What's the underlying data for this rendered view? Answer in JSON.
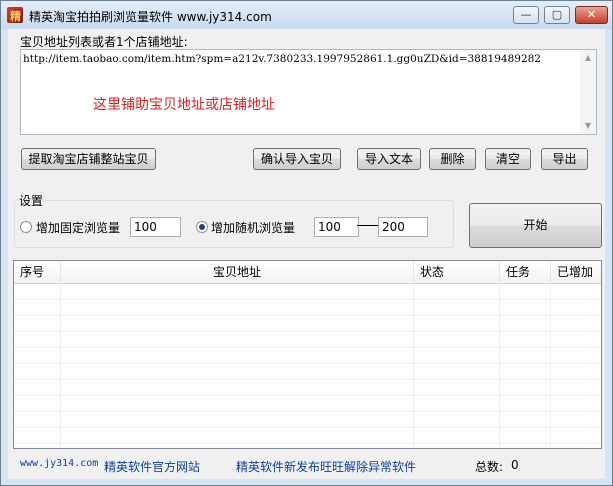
{
  "window": {
    "title": "精英淘宝拍拍刷浏览量软件 www.jy314.com",
    "minimize_glyph": "—",
    "maximize_glyph": "▢",
    "close_glyph": "✕"
  },
  "url_section": {
    "label": "宝贝地址列表或者1个店铺地址:",
    "value": "http://item.taobao.com/item.htm?spm=a212v.7380233.1997952861.1.gg0uZD&id=38819489282",
    "hint": "这里铺助宝贝地址或店铺地址"
  },
  "buttons": {
    "fetch_shop": "提取淘宝店铺整站宝贝",
    "confirm_import": "确认导入宝贝",
    "import_text": "导入文本",
    "delete": "删除",
    "clear": "清空",
    "export": "导出",
    "start": "开始"
  },
  "settings": {
    "title": "设置",
    "fixed_label": "增加固定浏览量",
    "fixed_selected": false,
    "fixed_value": "100",
    "random_label": "增加随机浏览量",
    "random_selected": true,
    "random_min": "100",
    "random_max": "200"
  },
  "table": {
    "columns": [
      "序号",
      "宝贝地址",
      "状态",
      "任务",
      "已增加"
    ],
    "rows": []
  },
  "footer": {
    "site": "www.jy314.com",
    "site_label": "精英软件官方网站",
    "news": "精英软件新发布旺旺解除异常软件",
    "total_label": "总数:",
    "total_value": "0"
  },
  "colors": {
    "hint": "#e02020",
    "link": "#0a3fa6",
    "client_bg": "#f0f0f0"
  },
  "icons": {
    "app": "app-logo-icon",
    "radio": "radio-button-icon"
  }
}
